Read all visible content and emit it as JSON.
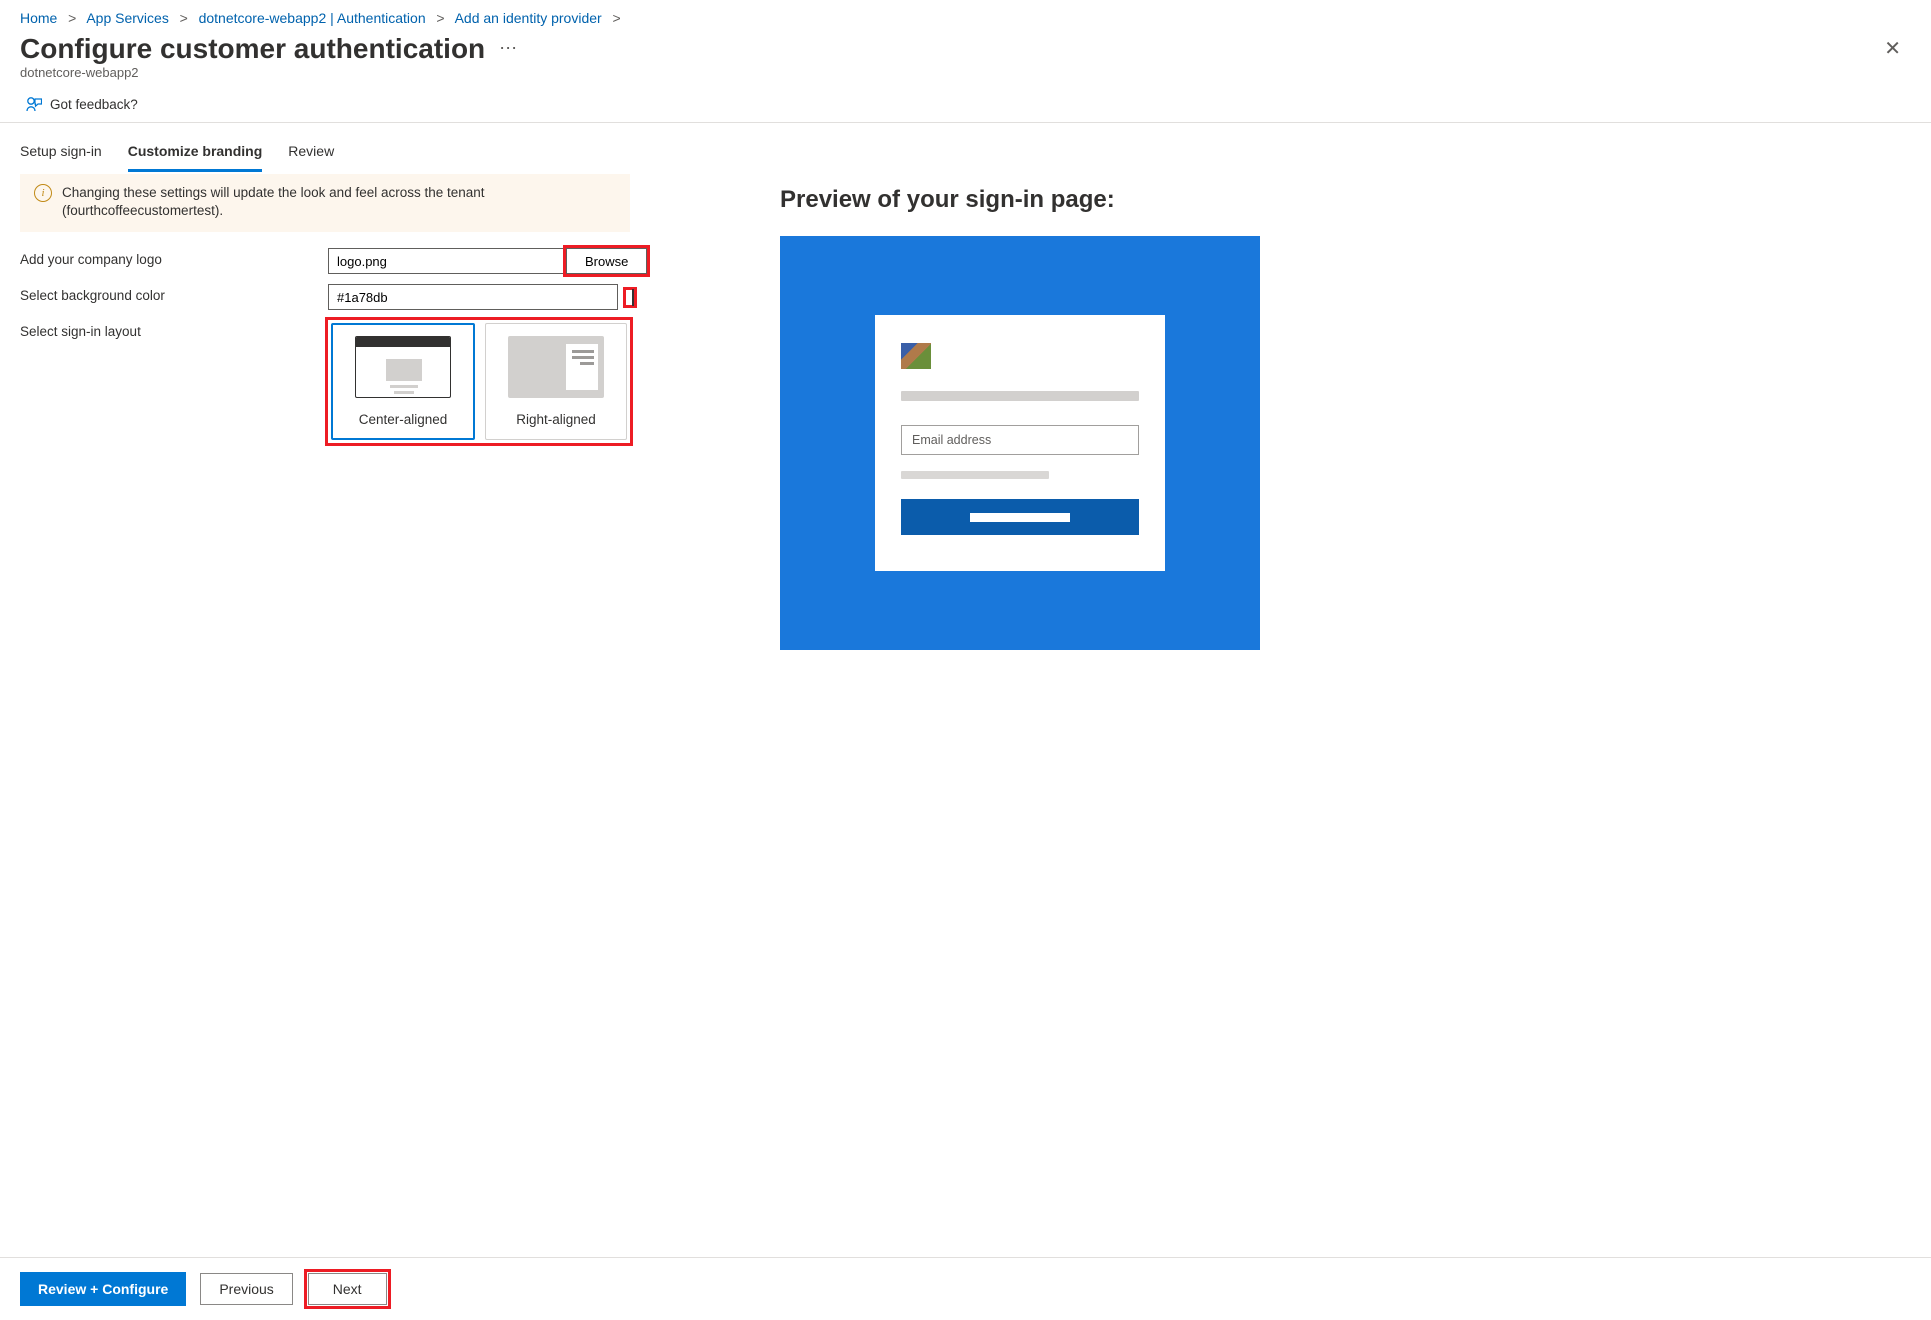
{
  "breadcrumb": {
    "items": [
      {
        "label": "Home"
      },
      {
        "label": "App Services"
      },
      {
        "label": "dotnetcore-webapp2 | Authentication"
      },
      {
        "label": "Add an identity provider"
      }
    ]
  },
  "page": {
    "title": "Configure customer authentication",
    "subtitle": "dotnetcore-webapp2"
  },
  "feedback": {
    "label": "Got feedback?"
  },
  "tabs": {
    "items": [
      {
        "label": "Setup sign-in",
        "active": false
      },
      {
        "label": "Customize branding",
        "active": true
      },
      {
        "label": "Review",
        "active": false
      }
    ]
  },
  "info": {
    "text": "Changing these settings will update the look and feel across the tenant (fourthcoffeecustomertest)."
  },
  "form": {
    "logo_label": "Add your company logo",
    "logo_value": "logo.png",
    "browse_label": "Browse",
    "bgcolor_label": "Select background color",
    "bgcolor_value": "#1a78db",
    "layout_label": "Select sign-in layout",
    "layout_options": {
      "center": "Center-aligned",
      "right": "Right-aligned"
    }
  },
  "preview": {
    "heading": "Preview of your sign-in page:",
    "email_placeholder": "Email address",
    "bg_color": "#1a78db"
  },
  "actions": {
    "review": "Review + Configure",
    "previous": "Previous",
    "next": "Next"
  }
}
